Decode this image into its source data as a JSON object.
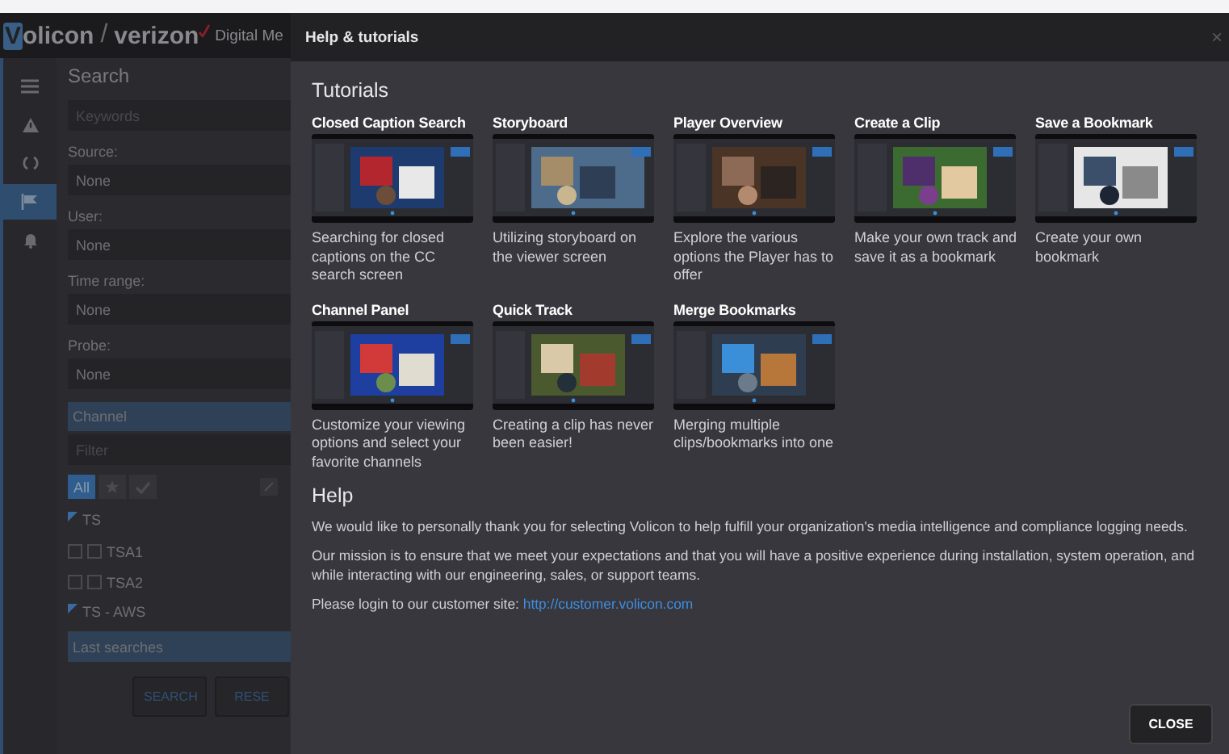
{
  "app": {
    "logo_initial": "V",
    "logo_rest": "olicon",
    "separator": "/",
    "brand": "verizon",
    "product": "Digital Me"
  },
  "rail": [
    {
      "kind": "menu",
      "selected": false
    },
    {
      "kind": "alert",
      "selected": false
    },
    {
      "kind": "sync",
      "selected": false
    },
    {
      "kind": "flag",
      "selected": true
    },
    {
      "kind": "bell",
      "selected": false
    }
  ],
  "search": {
    "title": "Search",
    "keywords": {
      "placeholder": "Keywords"
    },
    "fields": [
      {
        "label": "Source:",
        "value": "None"
      },
      {
        "label": "User:",
        "value": "None"
      },
      {
        "label": "Time range:",
        "value": "None"
      },
      {
        "label": "Probe:",
        "value": "None"
      }
    ],
    "channel_header": "Channel",
    "filter": {
      "placeholder": "Filter"
    },
    "filter_buttons": [
      {
        "kind": "text",
        "label": "All",
        "selected": true
      },
      {
        "kind": "star",
        "selected": false
      },
      {
        "kind": "check",
        "selected": false
      }
    ],
    "groups": [
      {
        "name": "TS",
        "items": [
          {
            "name": "TSA1",
            "checked": false
          },
          {
            "name": "TSA2",
            "checked": false
          }
        ]
      },
      {
        "name": "TS - AWS"
      }
    ],
    "last_searches": "Last searches",
    "buttons": [
      "SEARCH",
      "RESE"
    ]
  },
  "modal": {
    "title": "Help & tutorials",
    "close_glyph": "×",
    "tutorials_heading": "Tutorials",
    "tutorials": [
      {
        "title": "Closed Caption Search",
        "description": "Searching for closed captions on the CC search screen",
        "kind": "picture"
      },
      {
        "title": "Storyboard",
        "description": "Utilizing storyboard on the viewer screen",
        "kind": "picture"
      },
      {
        "title": "Player Overview",
        "description": "Explore the various options the Player has to offer",
        "kind": "picture"
      },
      {
        "title": "Create a Clip",
        "description": "Make your own track and save it as a bookmark",
        "kind": "picture"
      },
      {
        "title": "Save a Bookmark",
        "description": "Create your own bookmark",
        "kind": "picture"
      },
      {
        "title": "Channel Panel",
        "description": "Customize your viewing options and select your favorite channels",
        "kind": "picture"
      },
      {
        "title": "Quick Track",
        "description": "Creating a clip has never been easier!",
        "kind": "picture"
      },
      {
        "title": "Merge Bookmarks",
        "description": "Merging multiple clips/bookmarks into one",
        "kind": "picture"
      }
    ],
    "help_heading": "Help",
    "paragraphs": [
      "We would like to personally thank you for selecting Volicon to help fulfill your organization's media intelligence and compliance logging needs.",
      "Our mission is to ensure that we meet your expectations and that you will have a positive experience during installation, system operation, and while interacting with our engineering, sales, or support teams."
    ],
    "login_text": "Please login to our customer site:",
    "login_link": "http://customer.volicon.com",
    "close_button": "CLOSE"
  }
}
